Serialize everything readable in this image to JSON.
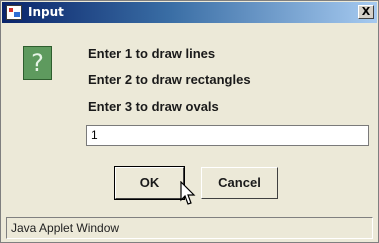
{
  "window": {
    "title": "Input",
    "close_label": "X",
    "app_icon": "java-applet-icon"
  },
  "dialog": {
    "icon": "question-icon",
    "icon_glyph": "?",
    "messages": [
      "Enter 1 to draw lines",
      "Enter 2 to draw rectangles",
      "Enter 3 to draw ovals"
    ],
    "input_value": "1",
    "ok_label": "OK",
    "cancel_label": "Cancel"
  },
  "status": {
    "text": "Java Applet Window"
  },
  "colors": {
    "title_start": "#0a246a",
    "title_end": "#a6caf0",
    "icon_green": "#5e9a5e",
    "background": "#ece9d8"
  }
}
